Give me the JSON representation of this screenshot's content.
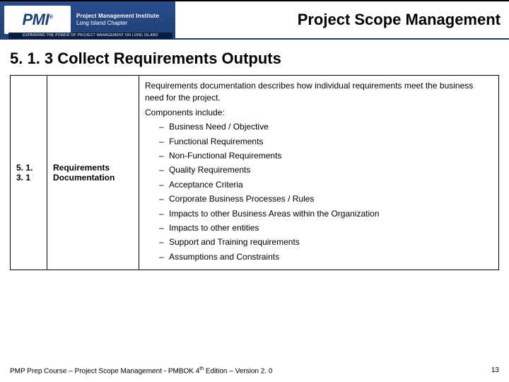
{
  "header": {
    "logo_text": "PMI",
    "logo_r": "®",
    "logo_line1": "Project Management Institute",
    "logo_line2": "Long Island Chapter",
    "logo_tagline": "EXPANDING THE POWER OF PROJECT MANAGEMENT ON LONG ISLAND",
    "title": "Project Scope Management"
  },
  "subhead": "5. 1. 3 Collect Requirements Outputs",
  "table": {
    "number": "5. 1. 3. 1",
    "name": "Requirements Documentation",
    "intro1": "Requirements documentation describes how individual requirements meet the business need for the project.",
    "intro2": "Components include:",
    "items": [
      "Business Need / Objective",
      "Functional Requirements",
      "Non-Functional Requirements",
      "Quality Requirements",
      "Acceptance Criteria",
      "Corporate Business Processes / Rules",
      "Impacts to other Business Areas within the Organization",
      "Impacts to other entities",
      "Support and Training requirements",
      "Assumptions and Constraints"
    ]
  },
  "footer": {
    "left_a": "PMP Prep Course – Project Scope Management - PMBOK 4",
    "left_sup": "th",
    "left_b": " Edition – Version 2. 0",
    "page": "13"
  }
}
